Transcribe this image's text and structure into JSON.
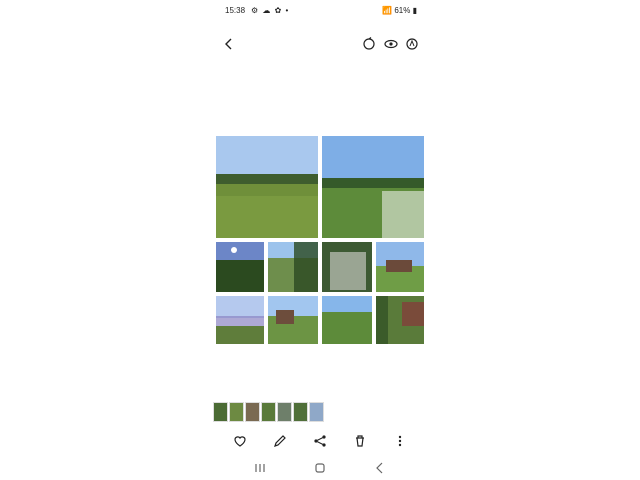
{
  "status": {
    "time": "15:38",
    "battery": "61%"
  },
  "icons": {
    "back": "back-arrow-icon",
    "rotate": "rotate-icon",
    "view": "eye-icon",
    "auto": "auto-adjust-icon",
    "favorite": "heart-icon",
    "edit": "pencil-icon",
    "share": "share-icon",
    "delete": "trash-icon",
    "more": "more-vertical-icon",
    "recents": "recent-apps-icon",
    "home": "home-icon",
    "nav_back": "nav-back-icon"
  },
  "colors": {
    "sky": "#8fb8e9",
    "field_green": "#6b8e3a",
    "dark_green": "#2f5b1e",
    "tree": "#3b5b2a"
  },
  "collage": {
    "large_images": 2,
    "small_images": 8
  },
  "filmstrip": {
    "thumbnails": 7
  }
}
